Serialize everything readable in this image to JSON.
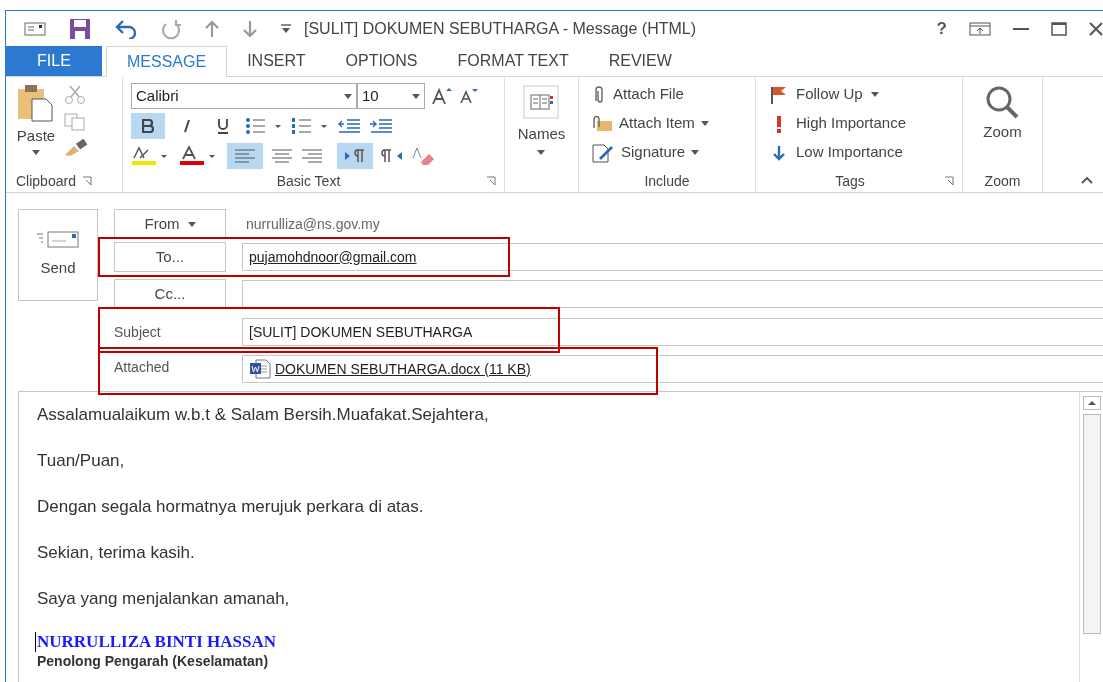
{
  "window": {
    "title": "[SULIT] DOKUMEN SEBUTHARGA - Message (HTML)",
    "help": "?"
  },
  "tabs": [
    {
      "label": "FILE",
      "kind": "file",
      "selected": false
    },
    {
      "label": "MESSAGE",
      "kind": "tab",
      "selected": true
    },
    {
      "label": "INSERT",
      "kind": "tab",
      "selected": false
    },
    {
      "label": "OPTIONS",
      "kind": "tab",
      "selected": false
    },
    {
      "label": "FORMAT TEXT",
      "kind": "tab",
      "selected": false
    },
    {
      "label": "REVIEW",
      "kind": "tab",
      "selected": false
    }
  ],
  "ribbon": {
    "clipboard": {
      "paste": "Paste",
      "label": "Clipboard"
    },
    "basic_text": {
      "font": "Calibri",
      "size": "10",
      "bold": true,
      "italic": false,
      "underline": false,
      "align_left": true,
      "left_to_right": true,
      "label": "Basic Text"
    },
    "names": {
      "label": "Names"
    },
    "include": {
      "items": [
        "Attach File",
        "Attach Item",
        "Signature"
      ],
      "label": "Include"
    },
    "tags": {
      "items": [
        "Follow Up",
        "High Importance",
        "Low Importance"
      ],
      "label": "Tags"
    },
    "zoom": {
      "button": "Zoom",
      "label": "Zoom"
    }
  },
  "header": {
    "send": "Send",
    "from": {
      "button": "From",
      "value": "nurrulliza@ns.gov.my"
    },
    "to": {
      "button": "To...",
      "value": "pujamohdnoor@gmail.com",
      "highlighted": true
    },
    "cc": {
      "button": "Cc..."
    },
    "subject": {
      "label": "Subject",
      "value": "[SULIT] DOKUMEN SEBUTHARGA",
      "highlighted": true
    },
    "attached": {
      "label": "Attached",
      "file": "DOKUMEN SEBUTHARGA.docx (11 KB)",
      "highlighted": true
    }
  },
  "body": {
    "paragraphs": [
      "Assalamualaikum w.b.t & Salam Bersih.Muafakat.Sejahtera,",
      "Tuan/Puan,",
      "Dengan segala hormatnya merujuk perkara di atas.",
      "Sekian, terima kasih.",
      "Saya yang menjalankan amanah,"
    ],
    "signature_name": "NURRULLIZA BINTI HASSAN",
    "signature_title": "Penolong Pengarah (Keselamatan)"
  }
}
